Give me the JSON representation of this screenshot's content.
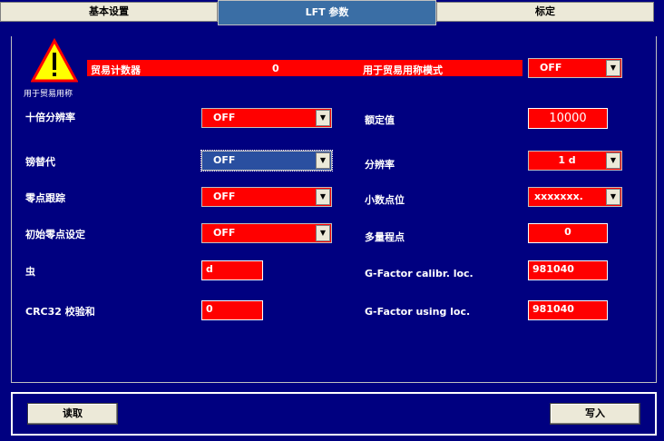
{
  "tabs": [
    {
      "label": "基本设置"
    },
    {
      "label": "LFT 参数"
    },
    {
      "label": "标定"
    }
  ],
  "warning": {
    "caption": "用于贸易用称",
    "counter_label": "贸易计数器",
    "counter_value": "0",
    "mode_label": "用于贸易用称模式",
    "mode_value": "OFF"
  },
  "left": {
    "decade_label": "十倍分辨率",
    "decade_value": "OFF",
    "replace_label": "镑替代",
    "replace_value": "OFF",
    "zero_track_label": "零点跟踪",
    "zero_track_value": "OFF",
    "init_zero_label": "初始零点设定",
    "init_zero_value": "OFF",
    "bug_label": "虫",
    "bug_value": "d",
    "crc_label": "CRC32 校验和",
    "crc_value": "0"
  },
  "right": {
    "rated_label": "额定值",
    "rated_value": "10000",
    "resolution_label": "分辨率",
    "resolution_value": "1 d",
    "decimal_label": "小数点位",
    "decimal_value": "xxxxxxx.",
    "multi_range_label": "多量程点",
    "multi_range_value": "0",
    "gcal_label": "G-Factor calibr. loc.",
    "gcal_value": "981040",
    "guse_label": "G-Factor using loc.",
    "guse_value": "981040"
  },
  "footer": {
    "read_label": "读取",
    "write_label": "写入"
  },
  "colors": {
    "background": "#000080",
    "field": "#ff0000",
    "tab_active": "#3a6ea5"
  }
}
